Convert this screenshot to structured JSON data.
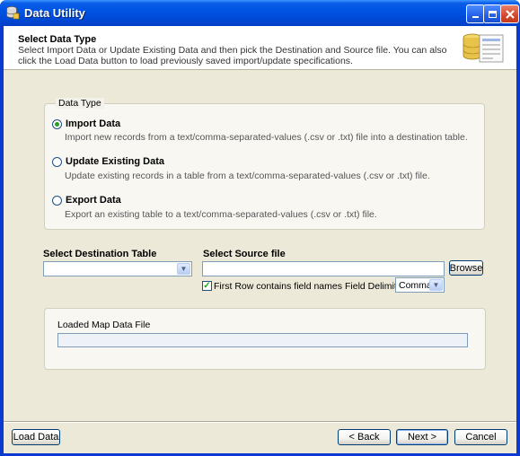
{
  "window": {
    "title": "Data Utility"
  },
  "header": {
    "title": "Select Data Type",
    "description": "Select Import Data or Update Existing Data and then pick the Destination and Source file.  You can also click the Load Data button to load previously saved import/update specifications."
  },
  "data_type": {
    "legend": "Data Type",
    "options": [
      {
        "label": "Import Data",
        "description": "Import new records from a text/comma-separated-values (.csv or .txt) file into a destination table.",
        "selected": true
      },
      {
        "label": "Update Existing Data",
        "description": "Update existing records in a table from a text/comma-separated-values (.csv or .txt) file.",
        "selected": false
      },
      {
        "label": "Export Data",
        "description": "Export an existing table to a text/comma-separated-values (.csv or .txt) file.",
        "selected": false
      }
    ]
  },
  "destination": {
    "label": "Select Destination Table",
    "value": ""
  },
  "source": {
    "label": "Select Source file",
    "value": "",
    "browse_label": "Browse",
    "first_row_label": "First Row contains field names",
    "first_row_checked": true,
    "delimiter_label": "Field Delimiter",
    "delimiter_value": "Comma"
  },
  "map": {
    "label": "Loaded Map Data File",
    "value": ""
  },
  "footer": {
    "load_label": "Load Data",
    "back_label": "< Back",
    "next_label": "Next >",
    "cancel_label": "Cancel"
  },
  "colors": {
    "titlebar": "#0054e3",
    "dialog_bg": "#ece9d8",
    "radio_dot": "#21a121"
  }
}
